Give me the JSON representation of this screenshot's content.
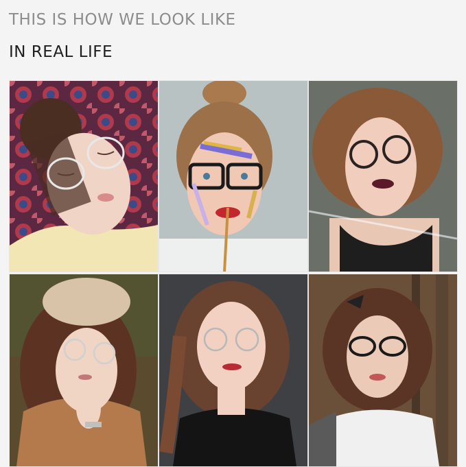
{
  "header": {
    "line1": "THIS IS HOW WE LOOK LIKE",
    "line2": "IN REAL LIFE"
  },
  "photos": [
    {
      "subject": "woman with eyes closed wearing clear round glasses, lying on a red paisley fabric",
      "glasses": "clear-round"
    },
    {
      "subject": "woman with top bun, face paint streaks, black square glasses, holding a paintbrush",
      "glasses": "black-square"
    },
    {
      "subject": "woman with short auburn hair, dark lipstick, round dark glasses",
      "glasses": "dark-round"
    },
    {
      "subject": "woman in beige beret with round wire glasses, hand on chin, autumn forest",
      "glasses": "wire-round"
    },
    {
      "subject": "woman with long brown hair, thin round metal glasses, black sweater",
      "glasses": "wire-round"
    },
    {
      "subject": "woman with curly brown hair and hair bow, black oval glasses, forest",
      "glasses": "black-oval"
    }
  ]
}
